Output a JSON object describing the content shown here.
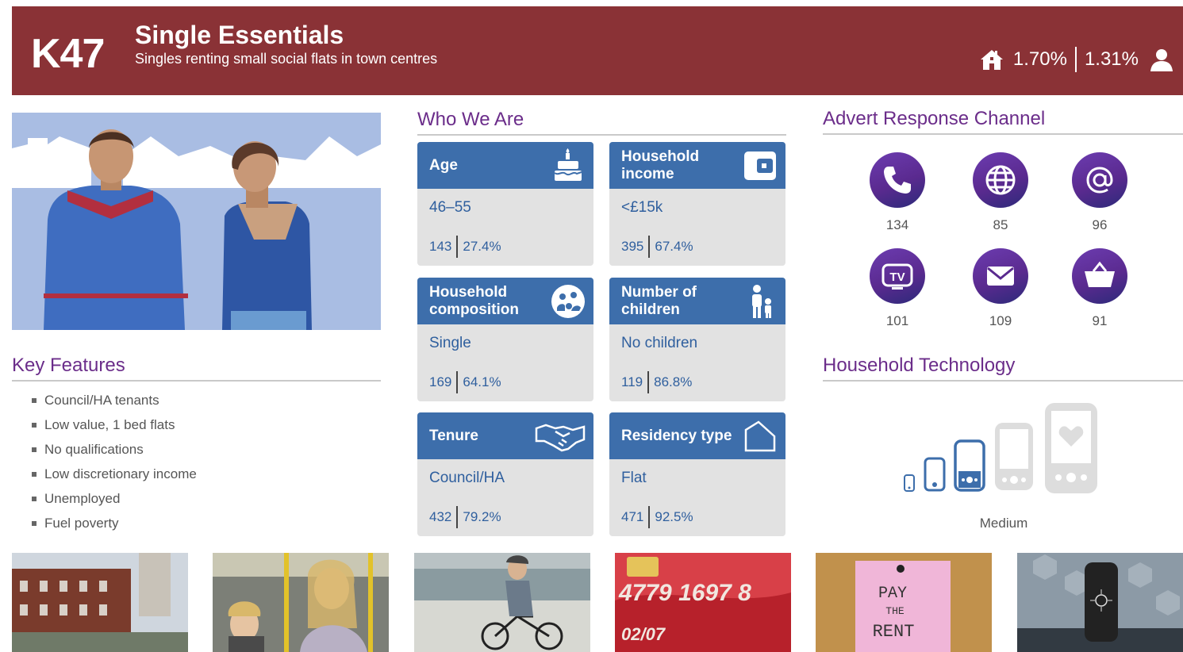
{
  "header": {
    "code": "K47",
    "title": "Single Essentials",
    "subtitle": "Singles renting small social flats in town centres",
    "household_pct": "1.70%",
    "person_pct": "1.31%",
    "color": "#8a3236",
    "icons": [
      "home-icon",
      "person-icon"
    ]
  },
  "key_features": {
    "title": "Key Features",
    "items": [
      "Council/HA tenants",
      "Low value, 1 bed flats",
      "No qualifications",
      "Low discretionary income",
      "Unemployed",
      "Fuel poverty"
    ]
  },
  "who_we_are": {
    "title": "Who We Are",
    "cards": [
      {
        "label": "Age",
        "value": "46–55",
        "index": "143",
        "pct": "27.4%",
        "icon": "birthday-cake-icon"
      },
      {
        "label": "Household income",
        "value": "<£15k",
        "index": "395",
        "pct": "67.4%",
        "icon": "wallet-icon"
      },
      {
        "label": "Household composition",
        "value": "Single",
        "index": "169",
        "pct": "64.1%",
        "icon": "household-icon"
      },
      {
        "label": "Number of children",
        "value": "No children",
        "index": "119",
        "pct": "86.8%",
        "icon": "parent-child-icon"
      },
      {
        "label": "Tenure",
        "value": "Council/HA",
        "index": "432",
        "pct": "79.2%",
        "icon": "handshake-icon"
      },
      {
        "label": "Residency type",
        "value": "Flat",
        "index": "471",
        "pct": "92.5%",
        "icon": "house-outline-icon"
      }
    ]
  },
  "advert": {
    "title": "Advert Response Channel",
    "channels": [
      {
        "icon": "phone-icon",
        "value": "134"
      },
      {
        "icon": "globe-icon",
        "value": "85"
      },
      {
        "icon": "at-sign-icon",
        "value": "96"
      },
      {
        "icon": "tv-icon",
        "value": "101"
      },
      {
        "icon": "envelope-icon",
        "value": "109"
      },
      {
        "icon": "shopping-basket-icon",
        "value": "91"
      }
    ]
  },
  "technology": {
    "title": "Household Technology",
    "level": "Medium",
    "level_of_5": 3
  },
  "photos": [
    "tenement-flats-photo",
    "bus-passengers-photo",
    "cyclist-photo",
    "credit-card-photo",
    "pay-the-rent-note-photo",
    "smart-device-photo"
  ],
  "photo_text": {
    "pay_the_rent": [
      "PAY",
      "THE",
      "RENT"
    ]
  }
}
